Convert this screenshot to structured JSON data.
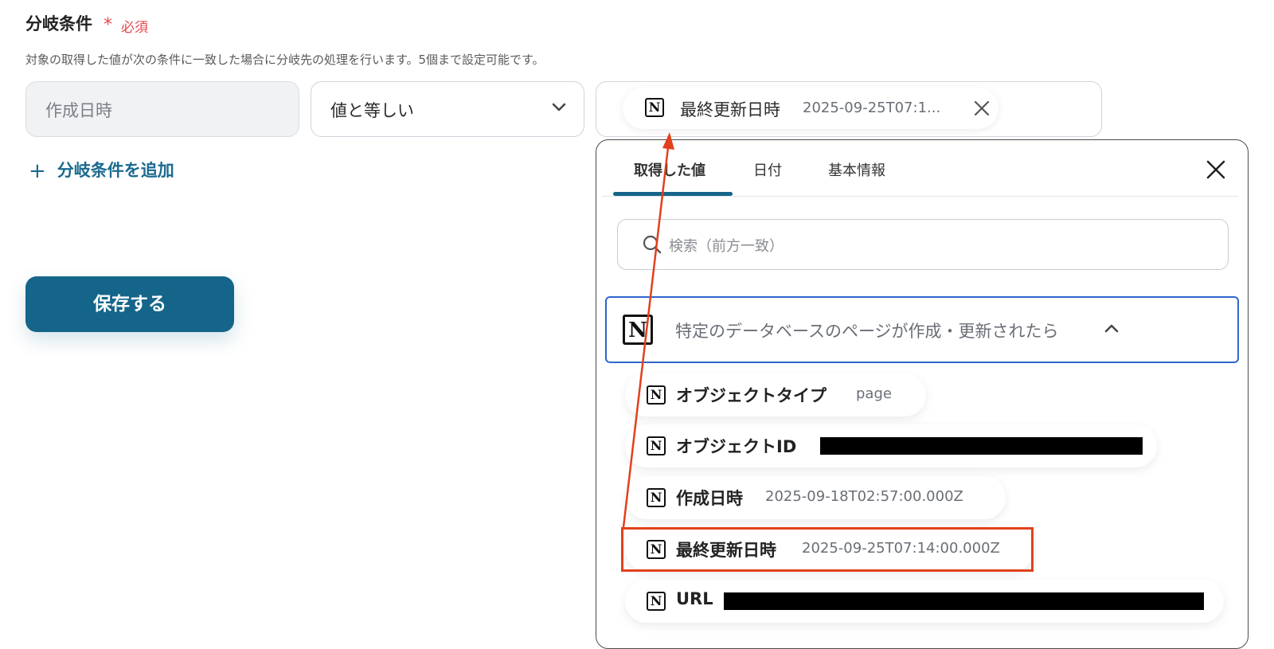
{
  "section": {
    "title": "分岐条件",
    "required_star": "*",
    "required_label": "必須",
    "description": "対象の取得した値が次の条件に一致した場合に分岐先の処理を行います。5個まで設定可能です。"
  },
  "condition": {
    "field_value": "作成日時",
    "operator_value": "値と等しい",
    "chip_label": "最終更新日時",
    "chip_value": "2025-09-25T07:1..."
  },
  "add_condition_label": "分岐条件を追加",
  "save_label": "保存する",
  "panel": {
    "tabs": [
      "取得した値",
      "日付",
      "基本情報"
    ],
    "active_tab": "取得した値",
    "search_placeholder": "検索（前方一致）",
    "group_title": "特定のデータベースのページが作成・更新されたら",
    "items": [
      {
        "label": "オブジェクトタイプ",
        "value": "page"
      },
      {
        "label": "オブジェクトID",
        "value": ""
      },
      {
        "label": "作成日時",
        "value": "2025-09-18T02:57:00.000Z"
      },
      {
        "label": "最終更新日時",
        "value": "2025-09-25T07:14:00.000Z"
      },
      {
        "label": "URL",
        "value": ""
      }
    ]
  },
  "icons": {
    "notion_glyph": "N",
    "chevron": "chevron-down-icon",
    "close": "close-icon",
    "search": "search-icon"
  },
  "colors": {
    "accent": "#15658a",
    "required": "#e5484d",
    "annotation": "#e2401c",
    "group_border": "#2f66d0"
  }
}
